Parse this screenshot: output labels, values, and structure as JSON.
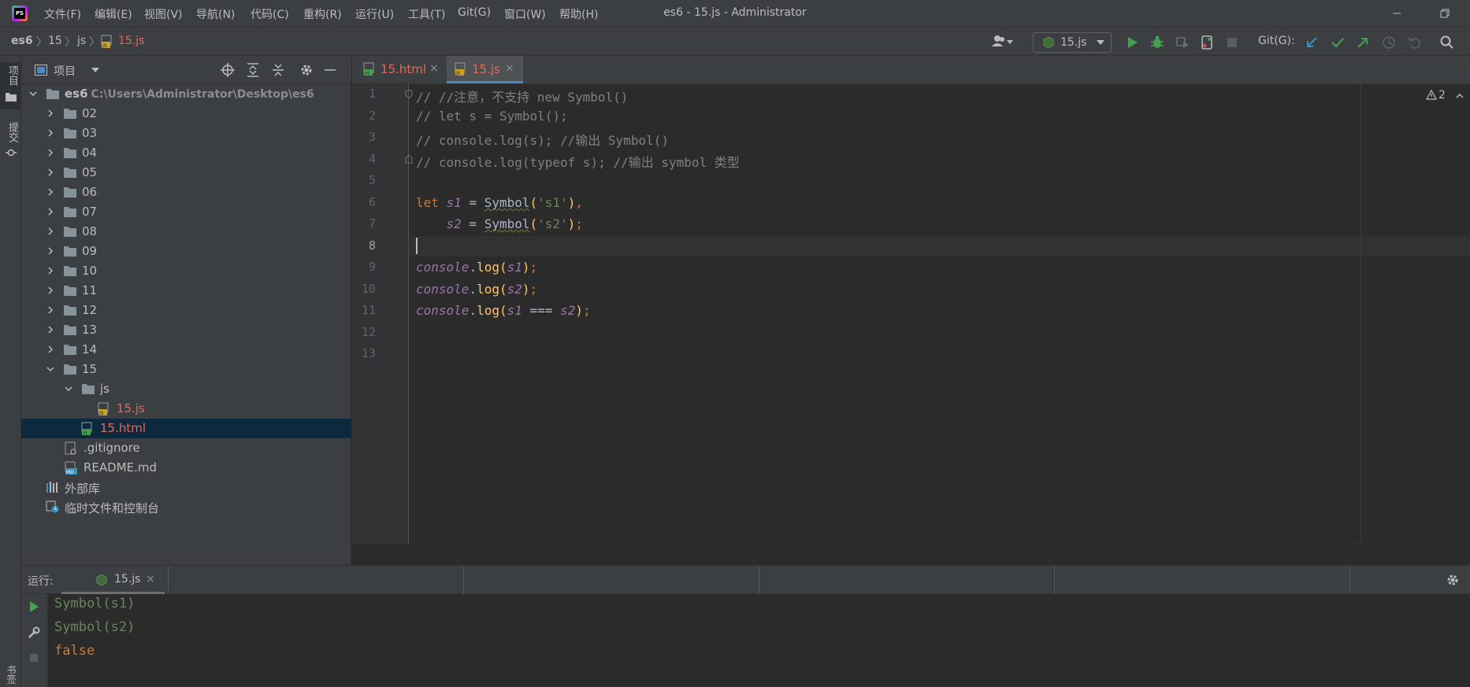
{
  "titlebar": {
    "app_badge": "PS",
    "menu": [
      "文件(F)",
      "编辑(E)",
      "视图(V)",
      "导航(N)",
      "代码(C)",
      "重构(R)",
      "运行(U)",
      "工具(T)",
      "Git(G)",
      "窗口(W)",
      "帮助(H)"
    ],
    "window_title": "es6 - 15.js - Administrator"
  },
  "navbar": {
    "breadcrumbs": [
      "es6",
      "15",
      "js",
      "15.js"
    ],
    "run_config": "15.js",
    "git_label": "Git(G):"
  },
  "left_stripe": {
    "project_tab": "项目",
    "commit_tab": "提交",
    "bottom_tab": "书签"
  },
  "project": {
    "title": "项目",
    "root_name": "es6",
    "root_path": "C:\\Users\\Administrator\\Desktop\\es6",
    "folders": [
      "02",
      "03",
      "04",
      "05",
      "06",
      "07",
      "08",
      "09",
      "10",
      "11",
      "12",
      "13",
      "14",
      "15"
    ],
    "subfolder": "js",
    "files": [
      "15.js",
      "15.html",
      ".gitignore",
      "README.md"
    ],
    "external_libs": "外部库",
    "scratches": "临时文件和控制台"
  },
  "editor": {
    "tabs": [
      {
        "label": "15.html",
        "close": "×"
      },
      {
        "label": "15.js",
        "close": "×"
      }
    ],
    "warnings": "2",
    "line_numbers": [
      "1",
      "2",
      "3",
      "4",
      "5",
      "6",
      "7",
      "8",
      "9",
      "10",
      "11",
      "12",
      "13"
    ],
    "code": {
      "l1": "// //注意，不支持 new Symbol()",
      "l2": "// let s = Symbol();",
      "l3": "// console.log(s); //输出 Symbol()",
      "l4": "// console.log(typeof s); //输出 symbol 类型",
      "l6_kw": "let",
      "l6_var": "s1",
      "l6_eq": " = ",
      "l6_fn": "Symbol",
      "l6_open": "(",
      "l6_str": "'s1'",
      "l6_close": ")",
      "l6_comma": ",",
      "l7_var": "s2",
      "l7_eq": " = ",
      "l7_fn": "Symbol",
      "l7_open": "(",
      "l7_str": "'s2'",
      "l7_close": ")",
      "l7_semi": ";",
      "console": "console",
      "dot": ".",
      "log": "log",
      "paren_open": "(",
      "paren_close": ")",
      "semi": ";",
      "l9_arg": "s1",
      "l10_arg": "s2",
      "l11_arg1": "s1",
      "l11_op": " === ",
      "l11_arg2": "s2"
    }
  },
  "run": {
    "label": "运行:",
    "tab": "15.js",
    "close": "×",
    "output": [
      "Symbol(s1)",
      "Symbol(s2)",
      "false"
    ]
  },
  "colors": {
    "accent": "#4a88c7",
    "comment": "#808080",
    "keyword": "#cc7832",
    "string": "#6a8759",
    "function": "#ffc66d",
    "variable": "#9876aa",
    "output_green": "#6a8759",
    "output_orange": "#cc7832"
  }
}
